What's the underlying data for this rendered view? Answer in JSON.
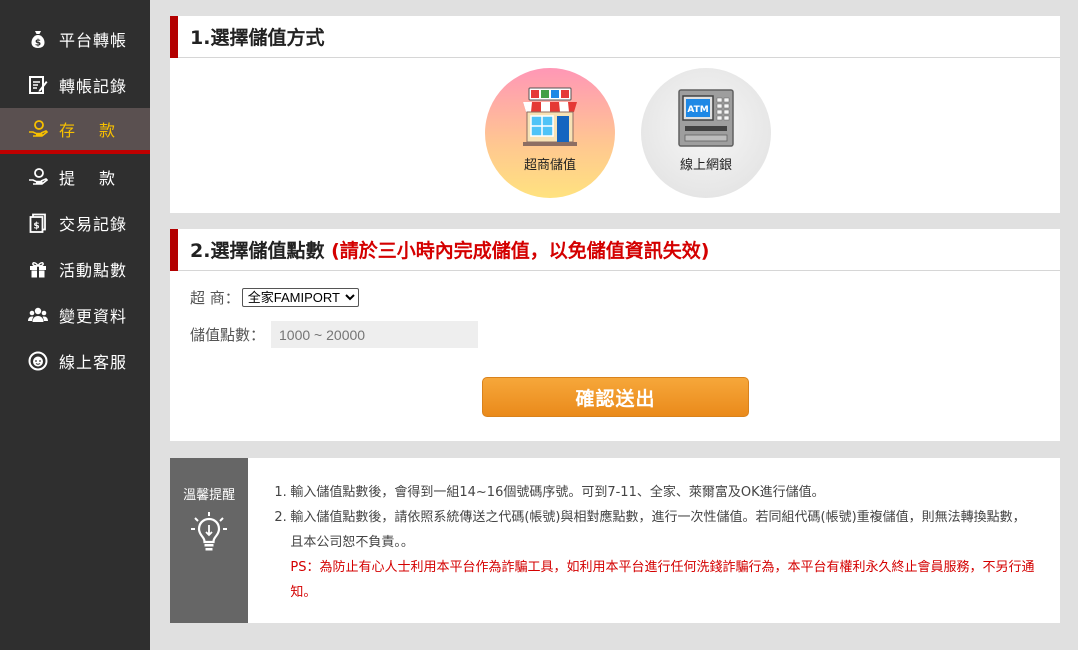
{
  "sidebar": {
    "items": [
      {
        "label": "平台轉帳",
        "icon": "money-bag-icon"
      },
      {
        "label": "轉帳記錄",
        "icon": "edit-note-icon"
      },
      {
        "label": "存款",
        "icon": "hand-coin-icon",
        "active": true
      },
      {
        "label": "提款",
        "icon": "hand-coin-icon"
      },
      {
        "label": "交易記錄",
        "icon": "receipt-icon"
      },
      {
        "label": "活動點數",
        "icon": "gift-icon"
      },
      {
        "label": "變更資料",
        "icon": "users-icon"
      },
      {
        "label": "線上客服",
        "icon": "support-icon"
      }
    ]
  },
  "section1": {
    "title": "1.選擇儲值方式",
    "methods": [
      {
        "label": "超商儲值",
        "icon": "convenience-store-icon"
      },
      {
        "label": "線上網銀",
        "icon": "atm-icon"
      }
    ]
  },
  "section2": {
    "title": "2.選擇儲值點數",
    "warning": "(請於三小時內完成儲值，以免儲值資訊失效)",
    "store_label": "超 商：",
    "store_selected": "全家FAMIPORT",
    "amount_label": "儲值點數：",
    "amount_placeholder": "1000 ~ 20000",
    "submit_label": "確認送出"
  },
  "tips": {
    "title": "溫馨提醒",
    "items": [
      {
        "num": "1.",
        "text": "輸入儲值點數後，會得到一組14~16個號碼序號。可到7-11、全家、萊爾富及OK進行儲值。"
      },
      {
        "num": "2.",
        "text": "輸入儲值點數後，請依照系統傳送之代碼(帳號)與相對應點數，進行一次性儲值。若同組代碼(帳號)重複儲值，則無法轉換點數，且本公司恕不負責。。"
      }
    ],
    "ps": "PS：為防止有心人士利用本平台作為詐騙工具，如利用本平台進行任何洗錢詐騙行為，本平台有權利永久終止會員服務，不另行通知。"
  },
  "colors": {
    "sidebar_bg": "#2f2f2f",
    "active_bg": "#5a5050",
    "active_text": "#f7c000",
    "accent_red": "#b30000",
    "warning_red": "#d40000",
    "button_orange": "#ea8a1b"
  }
}
